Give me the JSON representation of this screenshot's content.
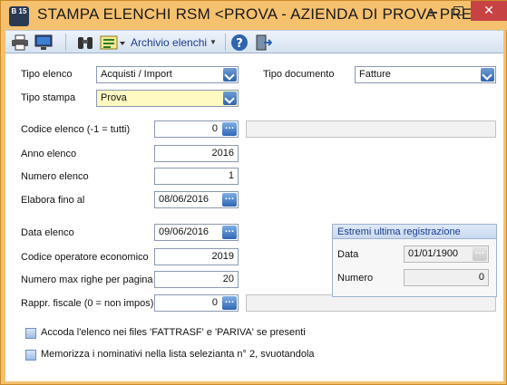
{
  "window": {
    "title": "STAMPA ELENCHI RSM <PROVA - AZIENDA DI PROVA PRE>",
    "app_icon_text": "B 15",
    "close_label": "✕"
  },
  "toolbar": {
    "archive_menu": "Archivio elenchi"
  },
  "form": {
    "tipo_elenco": {
      "label": "Tipo elenco",
      "value": "Acquisti / Import"
    },
    "tipo_documento": {
      "label": "Tipo documento",
      "value": "Fatture"
    },
    "tipo_stampa": {
      "label": "Tipo stampa",
      "value": "Prova"
    },
    "codice_elenco": {
      "label": "Codice elenco (-1 = tutti)",
      "value": "0"
    },
    "anno_elenco": {
      "label": "Anno elenco",
      "value": "2016"
    },
    "numero_elenco": {
      "label": "Numero elenco",
      "value": "1"
    },
    "elabora_fino": {
      "label": "Elabora fino al",
      "value": "08/06/2016"
    },
    "data_elenco": {
      "label": "Data elenco",
      "value": "09/06/2016"
    },
    "codice_operatore": {
      "label": "Codice operatore economico",
      "value": "2019"
    },
    "numero_max_righe": {
      "label": "Numero max righe per pagina",
      "value": "20"
    },
    "rappr_fiscale": {
      "label": "Rappr. fiscale (0 = non impos)",
      "value": "0"
    }
  },
  "estremi": {
    "title": "Estremi ultima registrazione",
    "data_label": "Data",
    "data_value": "01/01/1900",
    "numero_label": "Numero",
    "numero_value": "0"
  },
  "checkboxes": [
    {
      "label": "Accoda l'elenco nei files 'FATTRASF' e 'PARIVA' se presenti"
    },
    {
      "label": "Memorizza i nominativi nella lista selezianta n° 2, svuotandola"
    }
  ],
  "colors": {
    "titlebar": "#f5c16f",
    "toolbar_accent": "#1b3d8e",
    "button_blue": "#2f64ad",
    "highlight_field": "#fff9c2"
  }
}
